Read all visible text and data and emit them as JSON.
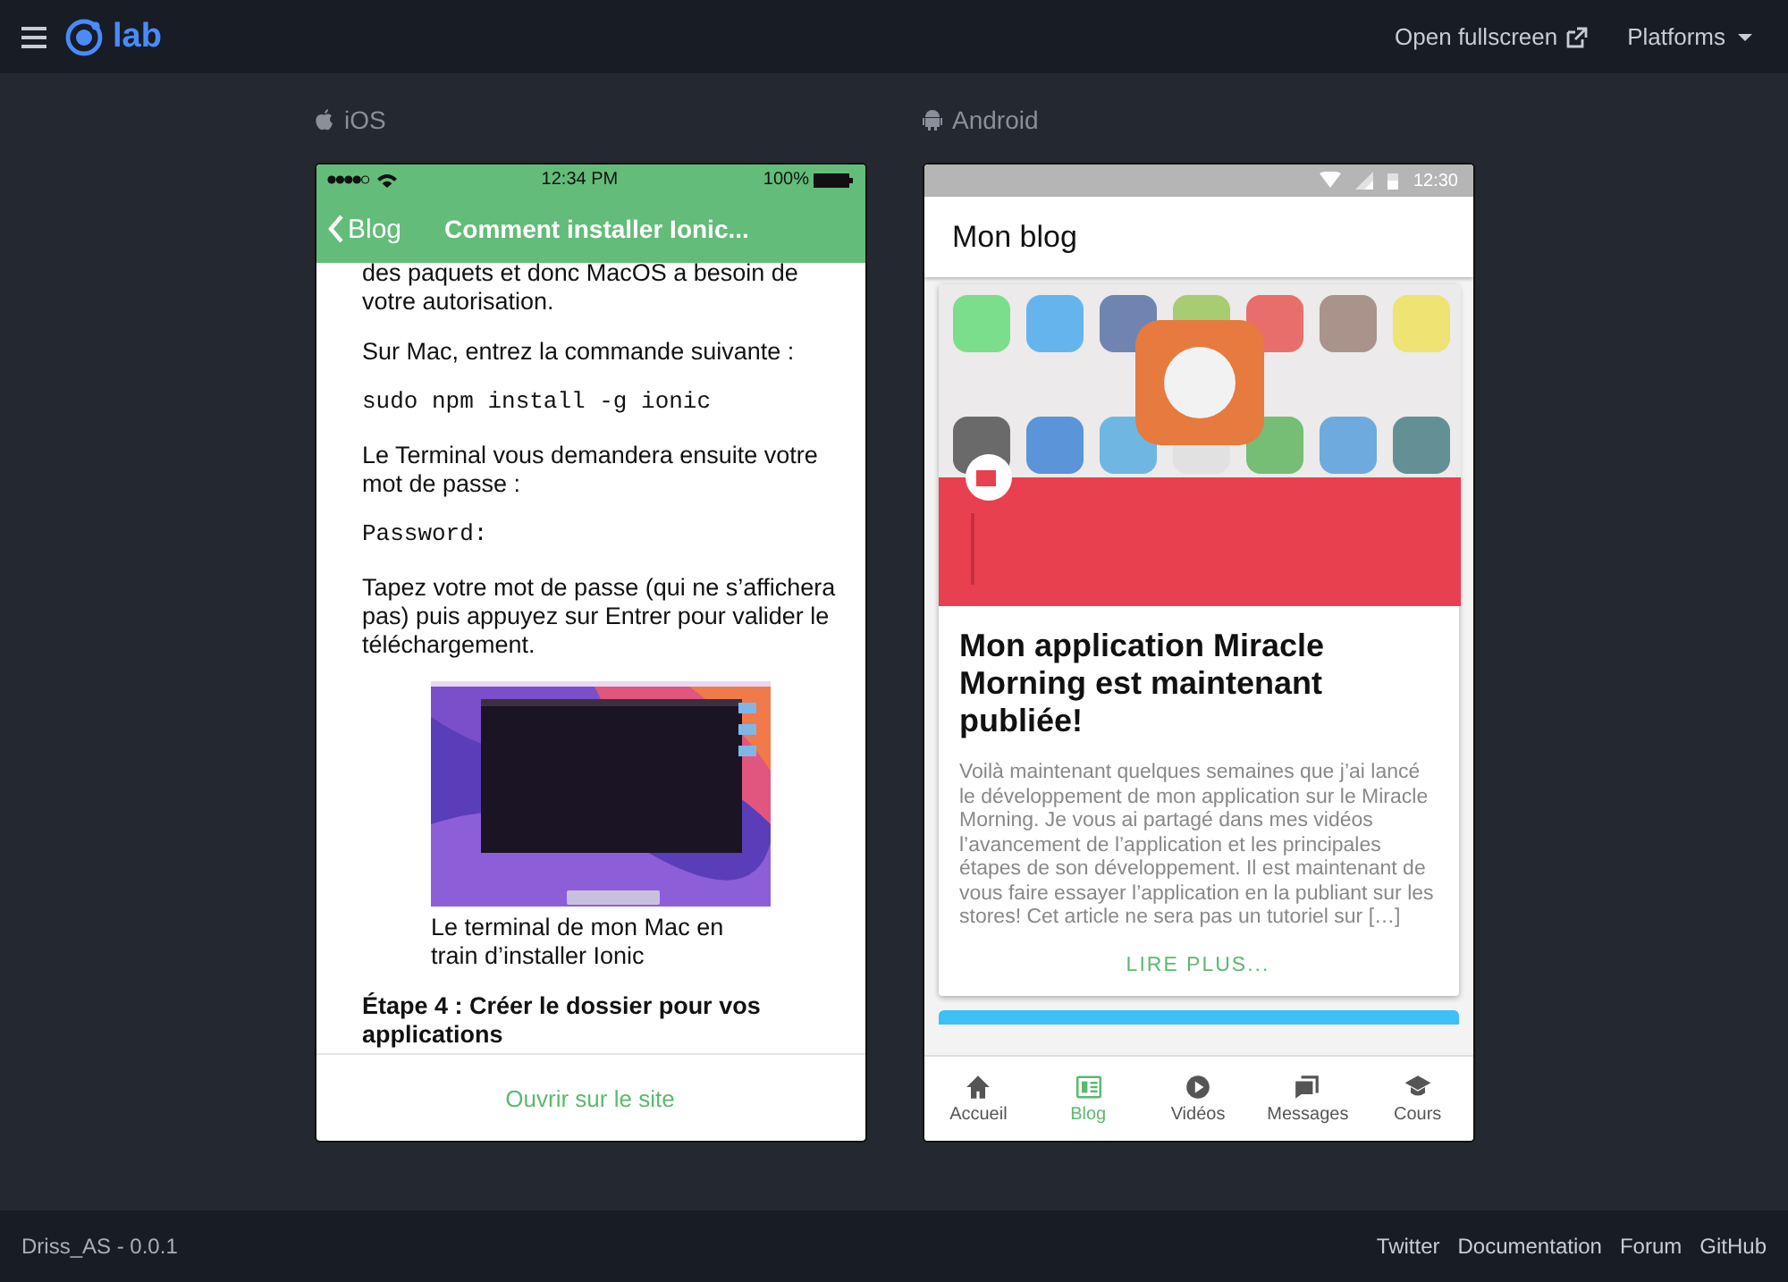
{
  "topbar": {
    "brand": "lab",
    "actions": [
      {
        "kind": "external",
        "label": "Open fullscreen"
      },
      {
        "kind": "dropdown",
        "label": "Platforms"
      }
    ]
  },
  "ios": {
    "label": "iOS",
    "status": {
      "time": "12:34 PM",
      "battery": "100%"
    },
    "nav": {
      "back": "Blog",
      "title": "Comment installer Ionic..."
    },
    "content": [
      {
        "kind": "text",
        "text": "des paquets et donc MacOS a besoin de votre autorisation."
      },
      {
        "kind": "text",
        "text": "Sur Mac, entrez la commande suivante :"
      },
      {
        "kind": "code",
        "text": "sudo npm install -g ionic"
      },
      {
        "kind": "text",
        "text": "Le Terminal vous demandera ensuite votre mot de passe :"
      },
      {
        "kind": "code",
        "text": "Password:"
      },
      {
        "kind": "text",
        "text": "Tapez votre mot de passe (qui ne s’affichera pas) puis appuyez sur Entrer pour valider le téléchargement."
      },
      {
        "kind": "figure",
        "caption": "Le terminal de mon Mac en train d’installer Ionic"
      },
      {
        "kind": "heading",
        "text": "Étape 4 : Créer le dossier pour vos applications"
      }
    ],
    "footer_link": "Ouvrir sur le site"
  },
  "android": {
    "label": "Android",
    "status": {
      "time": "12:30"
    },
    "toolbar_title": "Mon blog",
    "card": {
      "title": "Mon application Miracle Morning est maintenant publiée!",
      "excerpt": "Voilà maintenant quelques semaines que j’ai lancé le développement de mon application sur le Miracle Morning. Je vous ai partagé dans mes vidéos l’avancement de l’application et les principales étapes de son développement. Il est maintenant de vous faire essayer l’application en la publiant sur les stores! Cet article ne sera pas un tutoriel sur […]",
      "action": "LIRE PLUS..."
    },
    "tabs": [
      {
        "kind": "home",
        "label": "Accueil",
        "selected": false
      },
      {
        "kind": "news",
        "label": "Blog",
        "selected": true
      },
      {
        "kind": "play",
        "label": "Vidéos",
        "selected": false
      },
      {
        "kind": "messages",
        "label": "Messages",
        "selected": false
      },
      {
        "kind": "school",
        "label": "Cours",
        "selected": false
      }
    ]
  },
  "footer": {
    "version": "Driss_AS - 0.0.1",
    "links": [
      "Twitter",
      "Documentation",
      "Forum",
      "GitHub"
    ]
  }
}
